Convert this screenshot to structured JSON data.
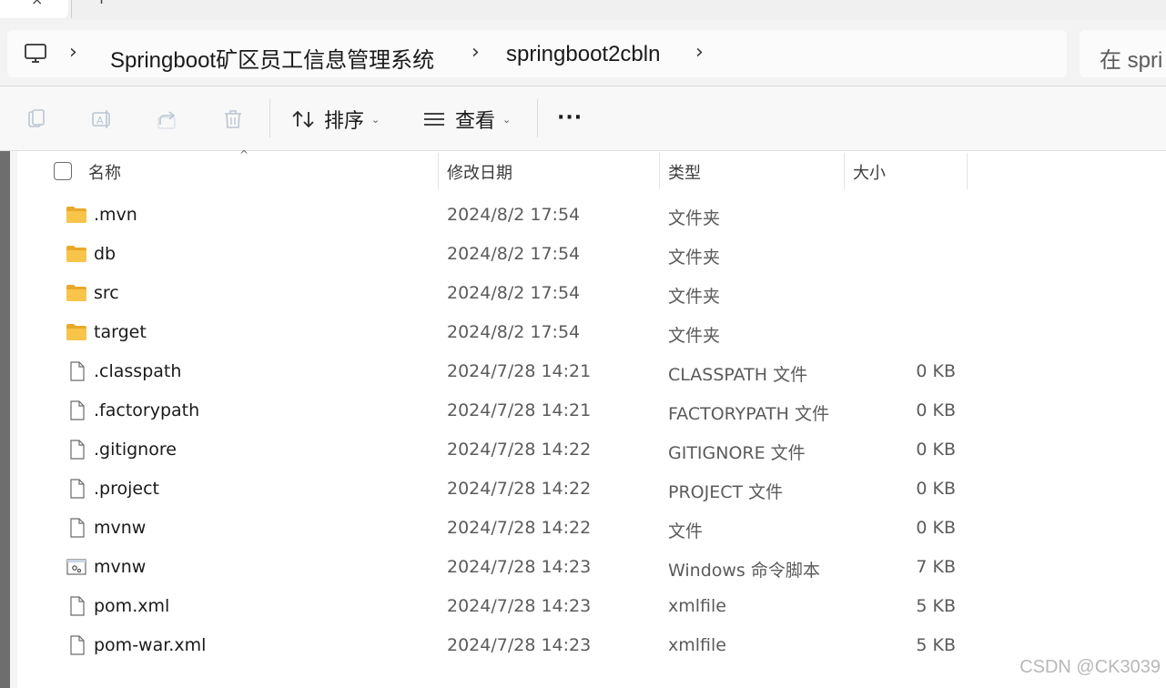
{
  "tabbar": {
    "close_glyph": "×",
    "new_tab_glyph": "+"
  },
  "breadcrumb": {
    "root_icon": "computer-icon",
    "items": [
      "Springboot矿区员工信息管理系统",
      "springboot2cbln"
    ]
  },
  "search": {
    "placeholder": "在 spri"
  },
  "toolbar": {
    "sort_label": "排序",
    "view_label": "查看",
    "more_label": "···",
    "icons": [
      "copy-icon",
      "rename-icon",
      "share-icon",
      "delete-icon"
    ]
  },
  "columns": {
    "name": "名称",
    "modified": "修改日期",
    "type": "类型",
    "size": "大小"
  },
  "files": [
    {
      "kind": "folder",
      "name": ".mvn",
      "modified": "2024/8/2 17:54",
      "type": "文件夹",
      "size": ""
    },
    {
      "kind": "folder",
      "name": "db",
      "modified": "2024/8/2 17:54",
      "type": "文件夹",
      "size": ""
    },
    {
      "kind": "folder",
      "name": "src",
      "modified": "2024/8/2 17:54",
      "type": "文件夹",
      "size": ""
    },
    {
      "kind": "folder",
      "name": "target",
      "modified": "2024/8/2 17:54",
      "type": "文件夹",
      "size": ""
    },
    {
      "kind": "file",
      "name": ".classpath",
      "modified": "2024/7/28 14:21",
      "type": "CLASSPATH 文件",
      "size": "0 KB"
    },
    {
      "kind": "file",
      "name": ".factorypath",
      "modified": "2024/7/28 14:21",
      "type": "FACTORYPATH 文件",
      "size": "0 KB"
    },
    {
      "kind": "file",
      "name": ".gitignore",
      "modified": "2024/7/28 14:22",
      "type": "GITIGNORE 文件",
      "size": "0 KB"
    },
    {
      "kind": "file",
      "name": ".project",
      "modified": "2024/7/28 14:22",
      "type": "PROJECT 文件",
      "size": "0 KB"
    },
    {
      "kind": "file",
      "name": "mvnw",
      "modified": "2024/7/28 14:22",
      "type": "文件",
      "size": "0 KB"
    },
    {
      "kind": "script",
      "name": "mvnw",
      "modified": "2024/7/28 14:23",
      "type": "Windows 命令脚本",
      "size": "7 KB"
    },
    {
      "kind": "file",
      "name": "pom.xml",
      "modified": "2024/7/28 14:23",
      "type": "xmlfile",
      "size": "5 KB"
    },
    {
      "kind": "file",
      "name": "pom-war.xml",
      "modified": "2024/7/28 14:23",
      "type": "xmlfile",
      "size": "5 KB"
    }
  ],
  "watermark": "CSDN @CK3039",
  "colors": {
    "folder": "#f8c44a",
    "folder_dark": "#e9a92a",
    "accent": "#0067c0"
  }
}
